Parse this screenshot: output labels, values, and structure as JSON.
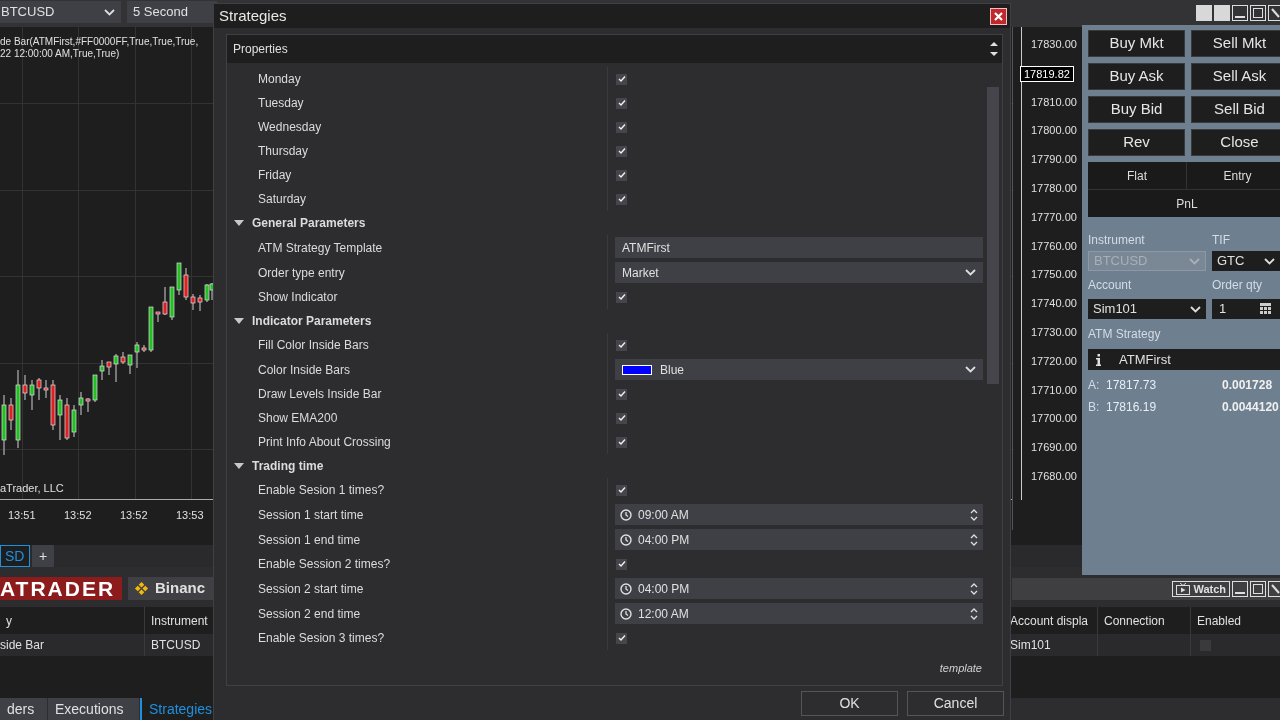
{
  "chart": {
    "instrument": "BTCUSD",
    "interval": "5 Second",
    "indicator_lines": [
      "de Bar(ATMFirst,#FF0000FF,True,True,True,",
      "22 12:00:00 AM,True,True)"
    ],
    "copyright": "aTrader, LLC",
    "time_labels": [
      "13:51",
      "13:52",
      "13:52",
      "13:53"
    ],
    "price_labels": [
      "17830.00",
      "17810.00",
      "17800.00",
      "17790.00",
      "17780.00",
      "17770.00",
      "17760.00",
      "17750.00",
      "17740.00",
      "17730.00",
      "17720.00",
      "17710.00",
      "17700.00",
      "17690.00",
      "17680.00"
    ],
    "current_price": "17819.82"
  },
  "chart_tabs": [
    {
      "label": "SD",
      "selected": true
    },
    {
      "label": "+",
      "selected": false
    }
  ],
  "connections": [
    {
      "label": "ATRADER",
      "kind": "logo"
    },
    {
      "label": "Binanc",
      "kind": "exchange"
    }
  ],
  "strategies_grid": {
    "columns": [
      "y",
      "Instrument"
    ],
    "row": [
      "side Bar",
      "BTCUSD"
    ],
    "right_columns": [
      "Account displa",
      "Connection",
      "Enabled"
    ],
    "right_row": {
      "account": "Sim101",
      "enabled": false
    }
  },
  "bottom_tabs": [
    {
      "label": "ders",
      "selected": false
    },
    {
      "label": "Executions",
      "selected": false
    },
    {
      "label": "Strategies",
      "selected": true
    }
  ],
  "watch_button": "Watch",
  "order_panel": {
    "buttons": [
      {
        "label": "Buy Mkt"
      },
      {
        "label": "Sell Mkt"
      },
      {
        "label": "Buy Ask"
      },
      {
        "label": "Sell Ask"
      },
      {
        "label": "Buy Bid"
      },
      {
        "label": "Sell Bid"
      },
      {
        "label": "Rev"
      },
      {
        "label": "Close"
      }
    ],
    "position": {
      "flat": "Flat",
      "entry": "Entry",
      "pnl": "PnL"
    },
    "instrument": {
      "label": "Instrument",
      "value": "BTCUSD",
      "disabled": true
    },
    "tif": {
      "label": "TIF",
      "value": "GTC"
    },
    "account": {
      "label": "Account",
      "value": "Sim101"
    },
    "order_qty": {
      "label": "Order qty",
      "value": "1"
    },
    "atm_strategy": {
      "label": "ATM Strategy",
      "value": "ATMFirst"
    },
    "quotes": [
      {
        "side": "A:",
        "price": "17817.73",
        "size": "0.001728"
      },
      {
        "side": "B:",
        "price": "17816.19",
        "size": "0.0044120"
      }
    ]
  },
  "dialog": {
    "title": "Strategies",
    "header": "Properties",
    "footer": "template",
    "buttons": [
      "OK",
      "Cancel"
    ],
    "items": [
      {
        "kind": "check",
        "label": "Monday",
        "checked": true
      },
      {
        "kind": "check",
        "label": "Tuesday",
        "checked": true
      },
      {
        "kind": "check",
        "label": "Wednesday",
        "checked": true
      },
      {
        "kind": "check",
        "label": "Thursday",
        "checked": true
      },
      {
        "kind": "check",
        "label": "Friday",
        "checked": true
      },
      {
        "kind": "check",
        "label": "Saturday",
        "checked": true
      },
      {
        "kind": "section",
        "label": "General Parameters",
        "expanded": true,
        "children": [
          {
            "kind": "text",
            "label": "ATM Strategy Template",
            "value": "ATMFirst"
          },
          {
            "kind": "select",
            "label": "Order type entry",
            "value": "Market"
          },
          {
            "kind": "check",
            "label": "Show Indicator",
            "checked": true
          }
        ]
      },
      {
        "kind": "section",
        "label": "Indicator Parameters",
        "expanded": true,
        "children": [
          {
            "kind": "check",
            "label": "Fill Color Inside Bars",
            "checked": true
          },
          {
            "kind": "color",
            "label": "Color Inside Bars",
            "value": "Blue",
            "color": "#0000ff"
          },
          {
            "kind": "check",
            "label": "Draw Levels Inside Bar",
            "checked": true
          },
          {
            "kind": "check",
            "label": "Show EMA200",
            "checked": true
          },
          {
            "kind": "check",
            "label": "Print Info About Crossing",
            "checked": true
          }
        ]
      },
      {
        "kind": "section",
        "label": "Trading time",
        "expanded": true,
        "children": [
          {
            "kind": "check",
            "label": "Enable Sesion 1 times?",
            "checked": true
          },
          {
            "kind": "time",
            "label": "Session 1 start time",
            "value": "09:00 AM"
          },
          {
            "kind": "time",
            "label": "Session 1 end time",
            "value": "04:00 PM"
          },
          {
            "kind": "check",
            "label": "Enable Session 2 times?",
            "checked": true
          },
          {
            "kind": "time",
            "label": "Session 2 start time",
            "value": "04:00 PM"
          },
          {
            "kind": "time",
            "label": "Session 2 end time",
            "value": "12:00 AM"
          },
          {
            "kind": "check",
            "label": "Enable Sesion 3 times?",
            "checked": true
          }
        ]
      }
    ]
  }
}
